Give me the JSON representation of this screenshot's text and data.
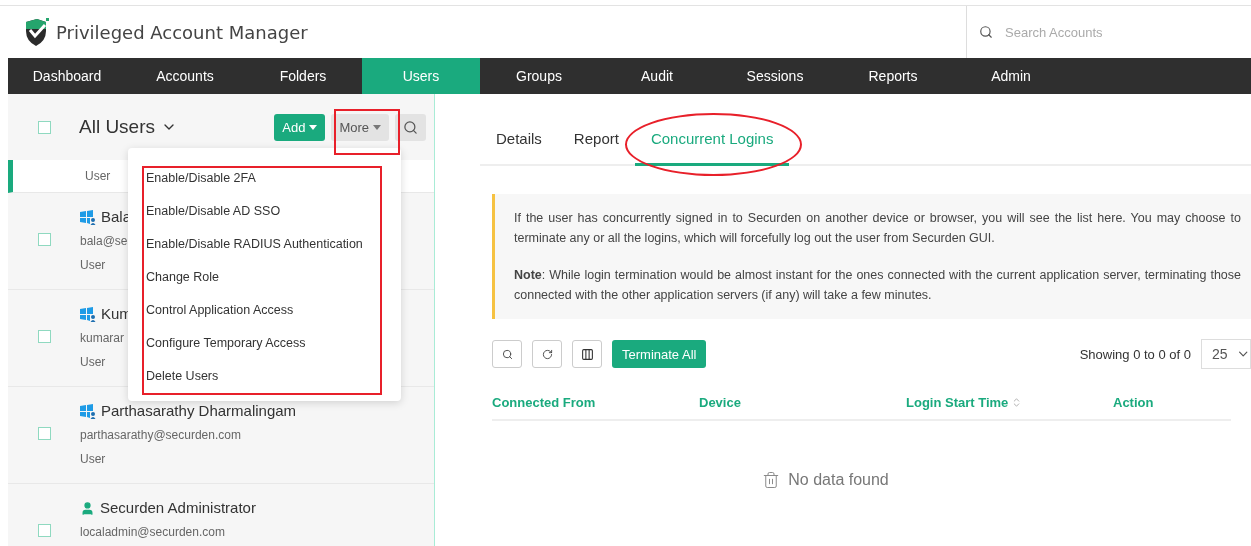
{
  "app": {
    "title": "Privileged Account Manager"
  },
  "search": {
    "placeholder": "Search Accounts"
  },
  "nav": [
    {
      "label": "Dashboard",
      "selected": false
    },
    {
      "label": "Accounts",
      "selected": false
    },
    {
      "label": "Folders",
      "selected": false
    },
    {
      "label": "Users",
      "selected": true
    },
    {
      "label": "Groups",
      "selected": false
    },
    {
      "label": "Audit",
      "selected": false
    },
    {
      "label": "Sessions",
      "selected": false
    },
    {
      "label": "Reports",
      "selected": false
    },
    {
      "label": "Admin",
      "selected": false
    }
  ],
  "users_panel": {
    "select_all_checked": false,
    "title": "All Users",
    "add_button": "Add",
    "more_button": "More",
    "users": [
      {
        "role": "User",
        "selected": true
      },
      {
        "kind": "windows",
        "name": "Bala",
        "email": "bala@se",
        "role": "User",
        "selected": false,
        "checked": false
      },
      {
        "kind": "windows",
        "name": "Kum",
        "email": "kumarar",
        "role": "User",
        "selected": false,
        "checked": false
      },
      {
        "kind": "windows",
        "name": "Parthasarathy Dharmalingam",
        "email": "parthasarathy@securden.com",
        "role": "User",
        "selected": false,
        "checked": false
      },
      {
        "kind": "local",
        "name": "Securden Administrator",
        "email": "localadmin@securden.com",
        "selected": false,
        "checked": false
      }
    ]
  },
  "more_menu": [
    "Enable/Disable 2FA",
    "Enable/Disable AD SSO",
    "Enable/Disable RADIUS Authentication",
    "Change Role",
    "Control Application Access",
    "Configure Temporary Access",
    "Delete Users"
  ],
  "tabs": [
    {
      "label": "Details",
      "selected": false
    },
    {
      "label": "Report",
      "selected": false
    },
    {
      "label": "Concurrent Logins",
      "selected": true
    }
  ],
  "info": {
    "text": "If the user has concurrently signed in to Securden on another device or browser, you will see the list here. You may choose to terminate any or all the logins, which will forcefully log out the user from Securden GUI.",
    "note": "**Note**: While login termination would be almost instant for the ones connected with the current application server, terminating those connected with the other application servers (if any) will take a few minutes."
  },
  "toolbar": {
    "terminate_button": "Terminate All",
    "showing": "Showing 0 to 0 of 0",
    "page_size": "25"
  },
  "table": {
    "columns": [
      {
        "label": "Connected From",
        "sortable": false
      },
      {
        "label": "Device",
        "sortable": false
      },
      {
        "label": "Login Start Time",
        "sortable": true
      },
      {
        "label": "Action",
        "sortable": false
      }
    ],
    "empty": "No data found"
  }
}
